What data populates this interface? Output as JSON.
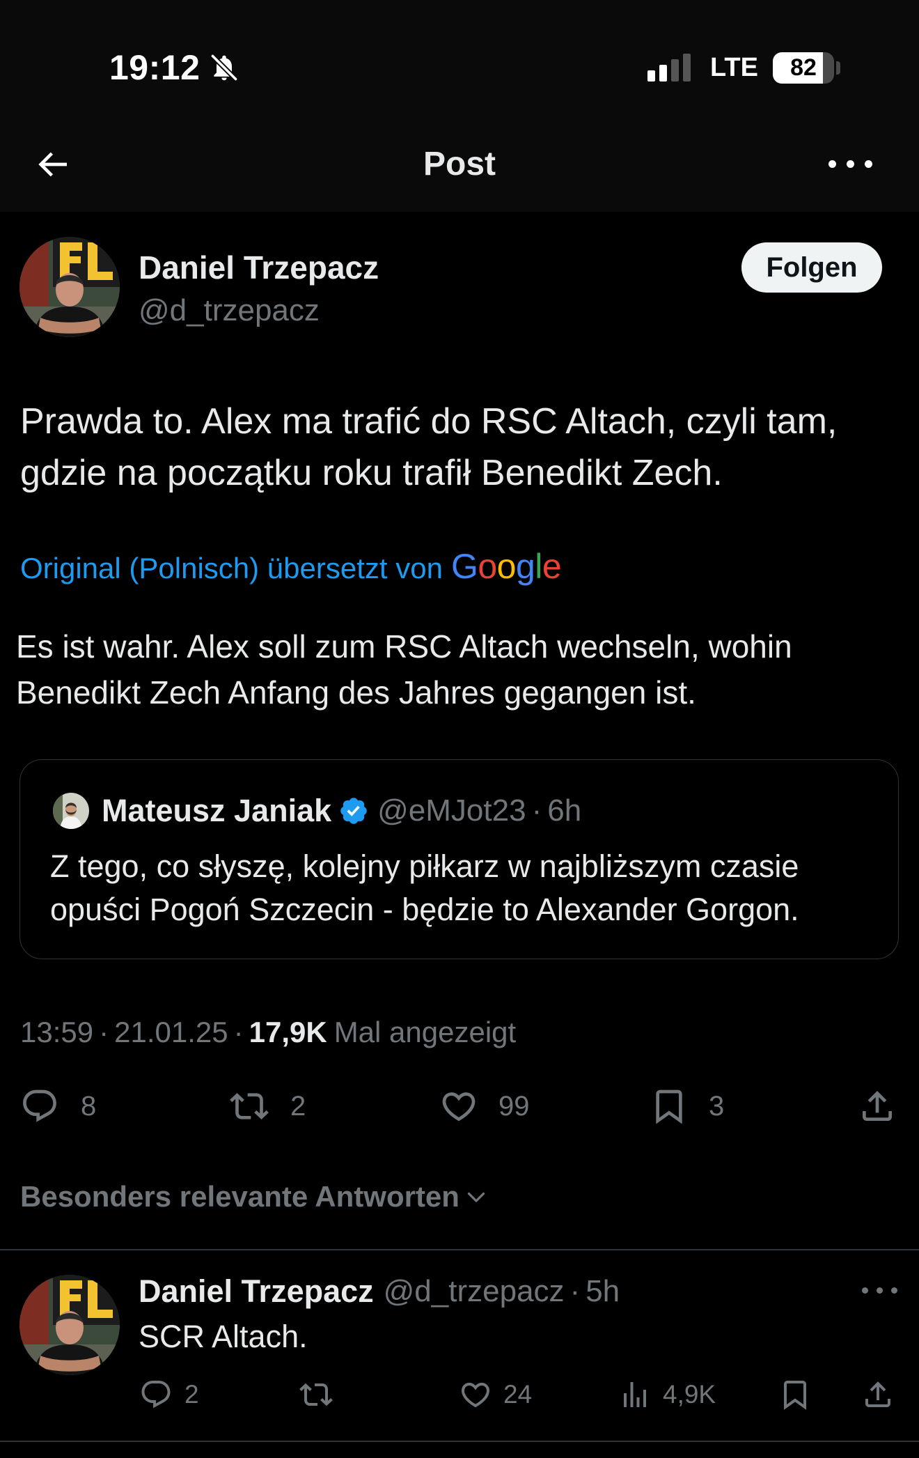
{
  "status_bar": {
    "time": "19:12",
    "network": "LTE",
    "battery": "82",
    "battery_level": 0.82,
    "signal_bars": {
      "filled": 2,
      "total": 4
    }
  },
  "header": {
    "title": "Post",
    "back_icon": "arrow-left-icon",
    "more_icon": "more-horizontal-icon"
  },
  "separator": "·",
  "post": {
    "author_name": "Daniel Trzepacz",
    "author_handle": "@d_trzepacz",
    "follow_label": "Folgen",
    "text_lines": [
      "Prawda to. Alex ma trafić do RSC Altach, czyli tam,",
      "gdzie na początku roku trafił Benedikt Zech."
    ],
    "translation": {
      "label": "Original (Polnisch) übersetzt von",
      "logo_text": "Google",
      "logo_colors": [
        "#4285F4",
        "#EA4335",
        "#FBBC05",
        "#4285F4",
        "#34A853",
        "#EA4335"
      ]
    },
    "translated_lines": [
      "Es ist wahr. Alex soll zum RSC Altach wechseln, wohin",
      "Benedikt Zech Anfang des Jahres gegangen ist."
    ],
    "quote": {
      "author_name": "Mateusz Janiak",
      "verified": true,
      "author_handle": "@eMJot23",
      "time": "6h",
      "text_lines": [
        "Z tego, co słyszę, kolejny piłkarz w najbliższym czasie",
        "opuści Pogoń Szczecin - będzie to Alexander Gorgon."
      ]
    },
    "meta": {
      "time": "13:59",
      "date": "21.01.25",
      "views": "17,9K",
      "views_label": "Mal angezeigt"
    },
    "actions": {
      "replies": "8",
      "reposts": "2",
      "likes": "99",
      "bookmarks": "3"
    }
  },
  "replies_sort": {
    "label": "Besonders relevante Antworten"
  },
  "replies": [
    {
      "author_name": "Daniel Trzepacz",
      "author_handle": "@d_trzepacz",
      "time": "5h",
      "text": "SCR Altach.",
      "replies": "2",
      "likes": "24",
      "views": "4,9K"
    }
  ],
  "colors": {
    "background": "#000000",
    "text": "#e7e9ea",
    "secondary": "#71767b",
    "accent": "#1d9bf0",
    "border": "#2f3336",
    "follow_button": "#eff3f4"
  }
}
